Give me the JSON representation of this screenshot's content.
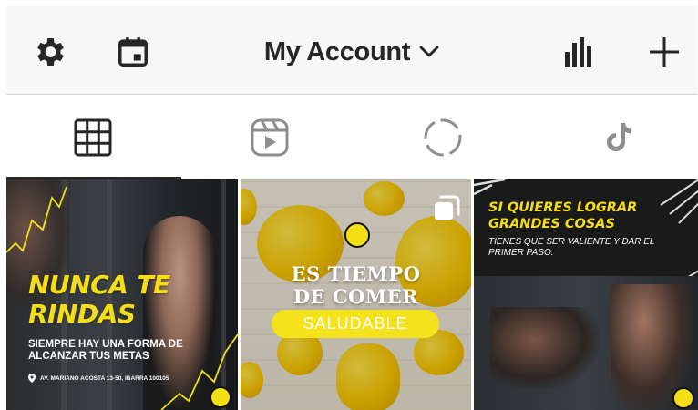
{
  "header": {
    "title": "My Account",
    "icons": {
      "settings": "gear-icon",
      "calendar": "calendar-icon",
      "dropdown": "chevron-down-icon",
      "insights": "bar-chart-icon",
      "add": "plus-icon"
    }
  },
  "tabs": [
    {
      "icon": "grid-icon",
      "selected": true
    },
    {
      "icon": "reels-icon",
      "selected": false
    },
    {
      "icon": "stories-icon",
      "selected": false
    },
    {
      "icon": "tiktok-icon",
      "selected": false
    }
  ],
  "posts": [
    {
      "headline": "NUNCA TE RINDAS",
      "headline_line1": "NUNCA TE",
      "headline_line2": "RINDAS",
      "subtext": "SIEMPRE HAY UNA FORMA DE ALCANZAR TUS METAS",
      "address": "AV. MARIANO ACOSTA 13-50, IBARRA 100105"
    },
    {
      "headline_line1": "ES TIEMPO",
      "headline_line2": "DE COMER",
      "pill": "SALUDABLE",
      "multi_icon": "carousel-icon"
    },
    {
      "headline": "SI QUIERES LOGRAR GRANDES COSAS",
      "subtext": "TIENES QUE SER VALIENTE Y DAR EL PRIMER PASO."
    }
  ],
  "colors": {
    "header_bg": "#f7f7f7",
    "text_dark": "#262626",
    "brand_yellow": "#f4de16"
  }
}
